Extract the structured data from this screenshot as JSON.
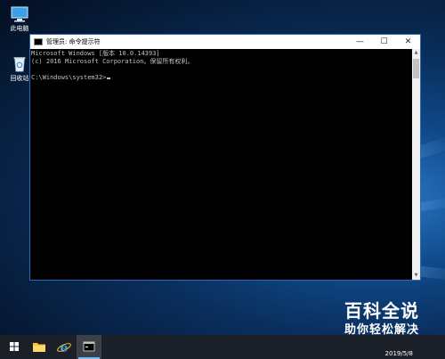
{
  "desktop": {
    "icons": [
      {
        "label": "此电脑",
        "icon": "this-pc-icon"
      },
      {
        "label": "回收站",
        "icon": "recycle-bin-icon"
      }
    ]
  },
  "console": {
    "title": "管理员: 命令提示符",
    "lines": [
      "Microsoft Windows [版本 10.0.14393]",
      "(c) 2016 Microsoft Corporation。保留所有权利。",
      "",
      "C:\\Windows\\system32>"
    ],
    "controls": {
      "minimize": "—",
      "maximize": "☐",
      "close": "✕"
    }
  },
  "taskbar": {
    "items": [
      {
        "icon": "windows-start-icon"
      },
      {
        "icon": "file-explorer-icon"
      },
      {
        "icon": "internet-explorer-icon"
      },
      {
        "icon": "command-prompt-icon",
        "active": true
      }
    ],
    "date": "2019/5/8"
  },
  "watermark": {
    "line1": "百科全说",
    "line2": "助你轻松解决"
  }
}
